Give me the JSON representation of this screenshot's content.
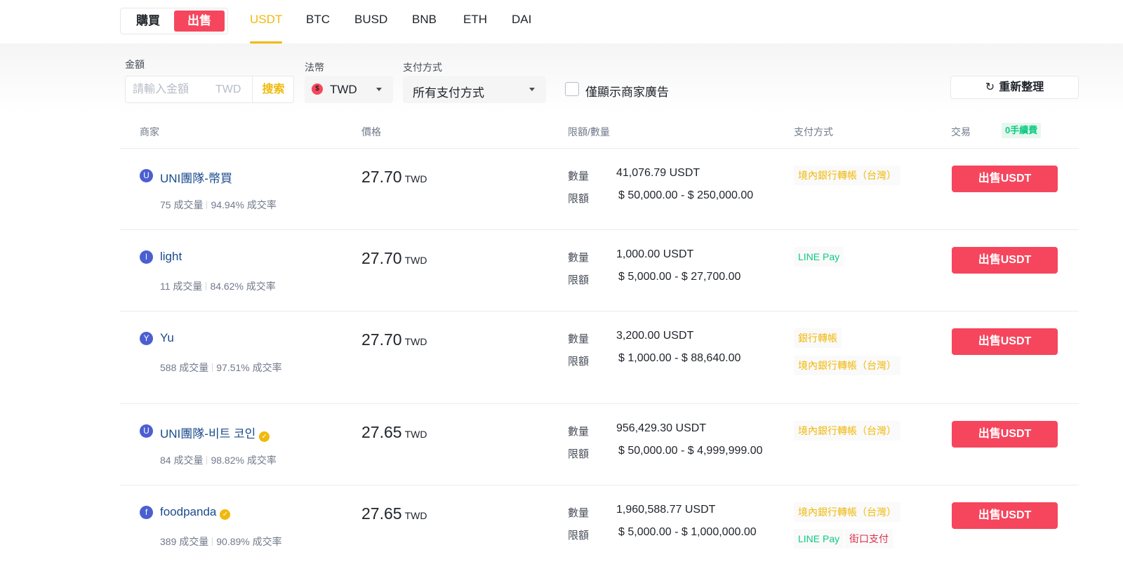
{
  "topbar": {
    "buy_label": "購買",
    "sell_label": "出售",
    "coin_tabs": [
      "USDT",
      "BTC",
      "BUSD",
      "BNB",
      "ETH",
      "DAI"
    ],
    "active_coin": "USDT"
  },
  "filters": {
    "amount_label": "金額",
    "amount_placeholder": "請輸入金額",
    "amount_currency": "TWD",
    "search_label": "搜索",
    "fiat_label": "法幣",
    "fiat_value": "TWD",
    "fiat_icon_symbol": "$",
    "payment_label": "支付方式",
    "payment_value": "所有支付方式",
    "merchant_only_label": "僅顯示商家廣告",
    "merchant_only_checked": false,
    "refresh_label": "重新整理"
  },
  "table": {
    "headers": {
      "merchant": "商家",
      "price": "價格",
      "limit": "限額/數量",
      "payment": "支付方式",
      "trade": "交易"
    },
    "zero_fee_badge": "0手續費",
    "quantity_label": "數量",
    "limit_label": "限額",
    "rows": [
      {
        "avatar": "U",
        "name": "UNI團隊-幣買",
        "verified": false,
        "orders": "75 成交量",
        "completion": "94.94% 成交率",
        "price": "27.70",
        "price_currency": "TWD",
        "quantity": "41,076.79 USDT",
        "limit": "$ 50,000.00 -  $ 250,000.00",
        "payments": [
          {
            "name": "境內銀行轉帳（台灣）",
            "color": "#f0b90b"
          }
        ],
        "action": "出售USDT"
      },
      {
        "avatar": "l",
        "name": "light",
        "verified": false,
        "orders": "11 成交量",
        "completion": "84.62% 成交率",
        "price": "27.70",
        "price_currency": "TWD",
        "quantity": "1,000.00 USDT",
        "limit": "$ 5,000.00 -  $ 27,700.00",
        "payments": [
          {
            "name": "LINE Pay",
            "color": "#0ecb81"
          }
        ],
        "action": "出售USDT"
      },
      {
        "avatar": "Y",
        "name": "Yu",
        "verified": false,
        "orders": "588 成交量",
        "completion": "97.51% 成交率",
        "price": "27.70",
        "price_currency": "TWD",
        "quantity": "3,200.00 USDT",
        "limit": "$ 1,000.00 -  $ 88,640.00",
        "payments": [
          {
            "name": "銀行轉帳",
            "color": "#f0b90b"
          },
          {
            "name": "境內銀行轉帳（台灣）",
            "color": "#f0b90b"
          }
        ],
        "action": "出售USDT"
      },
      {
        "avatar": "U",
        "name": "UNI團隊-비트 코인",
        "verified": true,
        "orders": "84 成交量",
        "completion": "98.82% 成交率",
        "price": "27.65",
        "price_currency": "TWD",
        "quantity": "956,429.30 USDT",
        "limit": "$ 50,000.00 -  $ 4,999,999.00",
        "payments": [
          {
            "name": "境內銀行轉帳（台灣）",
            "color": "#f0b90b"
          }
        ],
        "action": "出售USDT"
      },
      {
        "avatar": "f",
        "name": "foodpanda",
        "verified": true,
        "orders": "389 成交量",
        "completion": "90.89% 成交率",
        "price": "27.65",
        "price_currency": "TWD",
        "quantity": "1,960,588.77 USDT",
        "limit": "$ 5,000.00 -  $ 1,000,000.00",
        "payments": [
          {
            "name": "境內銀行轉帳（台灣）",
            "color": "#f0b90b"
          },
          {
            "name": "LINE Pay",
            "color": "#0ecb81"
          },
          {
            "name": "街口支付",
            "color": "#d9304e"
          }
        ],
        "action": "出售USDT"
      }
    ]
  },
  "colors": {
    "accent": "#f0b90b",
    "sell": "#f6465d",
    "merchant_link": "#1a4b8c",
    "avatar": "#4b5fd1"
  }
}
